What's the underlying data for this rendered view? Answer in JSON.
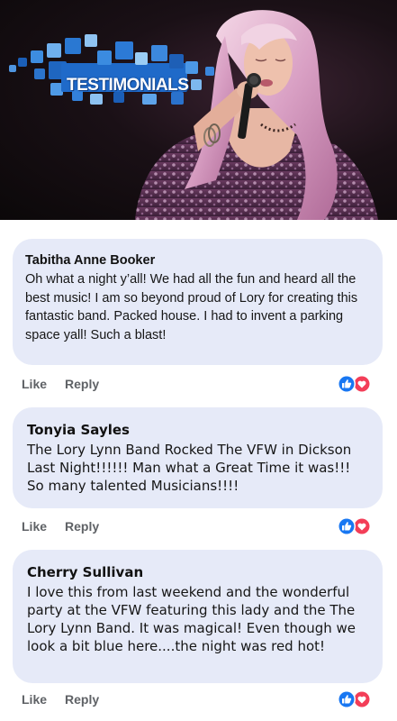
{
  "hero": {
    "logo_text": "TESTIMONIALS"
  },
  "comments": [
    {
      "author": "Tabitha Anne Booker",
      "text": "Oh what a night y’all! We had all the fun and heard all the best music! I am so beyond proud of Lory for creating this fantastic band. Packed house. I had to invent a parking space yall!  Such a blast!",
      "like_label": "Like",
      "reply_label": "Reply",
      "reactions": [
        "like-icon",
        "love-icon"
      ]
    },
    {
      "author": "Tonyia Sayles",
      "text": "The Lory Lynn Band Rocked The VFW in Dickson Last Night!!!!!! Man what a Great Time it was!!! So many talented Musicians!!!!",
      "like_label": "Like",
      "reply_label": "Reply",
      "reactions": [
        "like-icon",
        "love-icon"
      ]
    },
    {
      "author": "Cherry Sullivan",
      "text": "I love this from last weekend and the wonderful party at the VFW featuring this lady and the The Lory Lynn Band.  It was magical!  Even though we look a bit blue here....the night was red hot!",
      "like_label": "Like",
      "reply_label": "Reply",
      "reactions": [
        "like-icon",
        "love-icon"
      ]
    }
  ],
  "colors": {
    "comment_bubble": "#e6eaf8",
    "action_text": "#5f6266",
    "like_blue": "#1877f2",
    "love_red": "#f33e58",
    "logo_blue": "#2f7fd6"
  }
}
